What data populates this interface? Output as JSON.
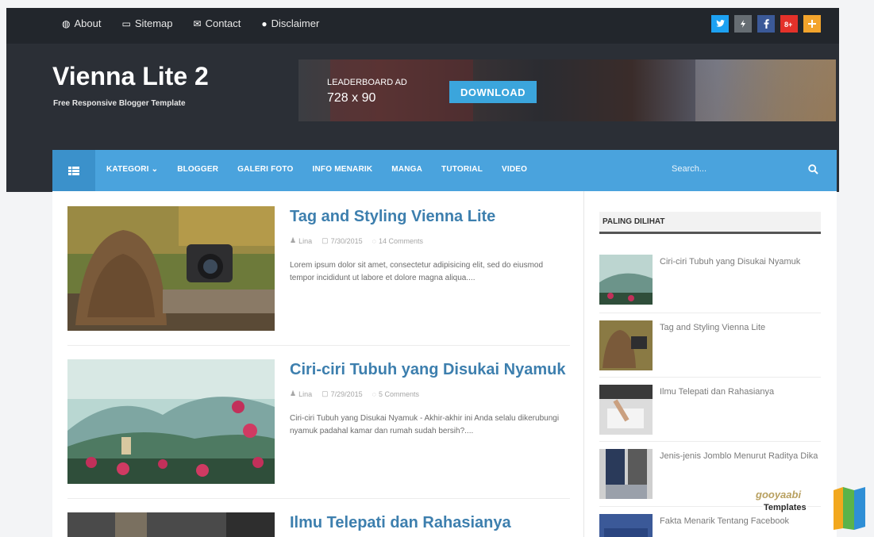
{
  "topbar": {
    "links": [
      {
        "label": "About",
        "icon": "globe-icon"
      },
      {
        "label": "Sitemap",
        "icon": "folder-icon"
      },
      {
        "label": "Contact",
        "icon": "envelope-icon"
      },
      {
        "label": "Disclaimer",
        "icon": "alert-icon"
      }
    ],
    "social": [
      {
        "icon": "twitter-icon",
        "glyph": "t",
        "color": "#1da1f2"
      },
      {
        "icon": "flickr-icon",
        "glyph": "/",
        "color": "#666d73"
      },
      {
        "icon": "facebook-icon",
        "glyph": "f",
        "color": "#3b5998"
      },
      {
        "icon": "google-plus-icon",
        "glyph": "8+",
        "color": "#e4312a"
      },
      {
        "icon": "plus-icon",
        "glyph": "+",
        "color": "#f3a42c"
      }
    ]
  },
  "site": {
    "title": "Vienna Lite 2",
    "tagline": "Free Responsive Blogger Template"
  },
  "ad": {
    "label": "LEADERBOARD AD",
    "size": "728 x 90",
    "button": "DOWNLOAD"
  },
  "nav": {
    "items": [
      "KATEGORI ⌄",
      "BLOGGER",
      "GALERI FOTO",
      "INFO MENARIK",
      "MANGA",
      "TUTORIAL",
      "VIDEO"
    ],
    "search_placeholder": "Search..."
  },
  "posts": [
    {
      "title": "Tag and Styling Vienna Lite",
      "author": "Lina",
      "date": "7/30/2015",
      "comments": "14 Comments",
      "excerpt": "Lorem ipsum dolor sit amet, consectetur adipisicing elit, sed do eiusmod tempor incididunt ut labore et dolore magna aliqua...."
    },
    {
      "title": "Ciri-ciri Tubuh yang Disukai Nyamuk",
      "author": "Lina",
      "date": "7/29/2015",
      "comments": "5 Comments",
      "excerpt": "Ciri-ciri Tubuh yang Disukai Nyamuk - Akhir-akhir ini Anda selalu dikerubungi nyamuk padahal kamar dan rumah sudah bersih?...."
    },
    {
      "title": "Ilmu Telepati dan Rahasianya"
    }
  ],
  "sidebar": {
    "heading": "PALING DILIHAT",
    "items": [
      "Ciri-ciri Tubuh yang Disukai Nyamuk",
      "Tag and Styling Vienna Lite",
      "Ilmu Telepati dan Rahasianya",
      "Jenis-jenis Jomblo Menurut Raditya Dika",
      "Fakta Menarik Tentang Facebook"
    ]
  },
  "watermark": {
    "line1": "gooyaabi",
    "line2": "Templates"
  }
}
